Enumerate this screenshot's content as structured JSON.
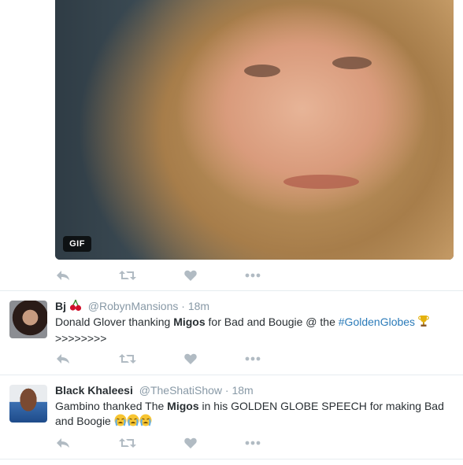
{
  "media": {
    "badge": "GIF"
  },
  "tweets": [
    {
      "name": "Bj",
      "name_emoji": "cherries-emoji",
      "handle": "@RobynMansions",
      "dot": "·",
      "time": "18m",
      "line1_pre": "Donald Glover thanking ",
      "line1_bold": "Migos",
      "line1_mid": " for Bad and Bougie @ the ",
      "hashtag": "#GoldenGlobes",
      "line2": ">>>>>>>>"
    },
    {
      "name": "Black Khaleesi",
      "handle": "@TheShatiShow",
      "dot": "·",
      "time": "18m",
      "line1_pre": "Gambino thanked The ",
      "line1_bold": "Migos",
      "line1_post": " in his GOLDEN GLOBE SPEECH for making Bad",
      "line2": "and Boogie"
    }
  ],
  "icons": {
    "reply": "reply-icon",
    "retweet": "retweet-icon",
    "like": "heart-icon",
    "more": "more-icon"
  },
  "colors": {
    "action_icon": "#b1bbc3",
    "hashtag": "#2b7bb9",
    "secondary_text": "#8899a6"
  }
}
